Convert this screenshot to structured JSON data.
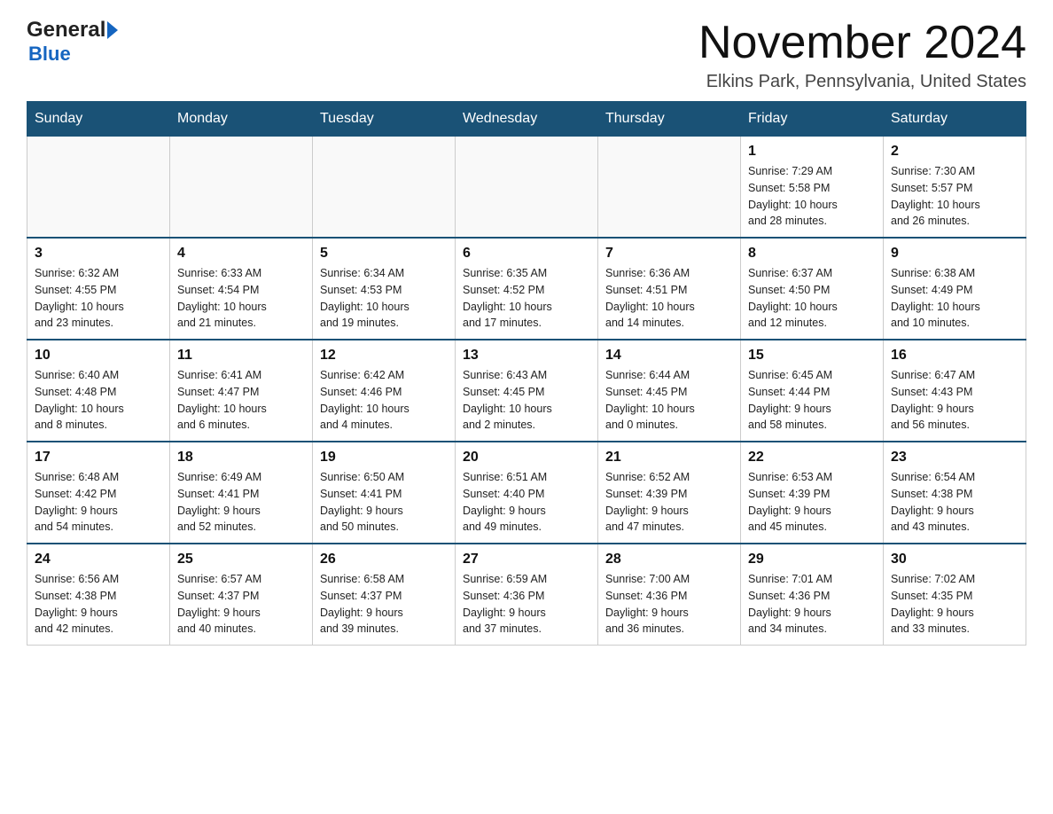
{
  "logo": {
    "general": "General",
    "blue": "Blue"
  },
  "title": "November 2024",
  "subtitle": "Elkins Park, Pennsylvania, United States",
  "weekdays": [
    "Sunday",
    "Monday",
    "Tuesday",
    "Wednesday",
    "Thursday",
    "Friday",
    "Saturday"
  ],
  "weeks": [
    [
      {
        "day": "",
        "info": ""
      },
      {
        "day": "",
        "info": ""
      },
      {
        "day": "",
        "info": ""
      },
      {
        "day": "",
        "info": ""
      },
      {
        "day": "",
        "info": ""
      },
      {
        "day": "1",
        "info": "Sunrise: 7:29 AM\nSunset: 5:58 PM\nDaylight: 10 hours\nand 28 minutes."
      },
      {
        "day": "2",
        "info": "Sunrise: 7:30 AM\nSunset: 5:57 PM\nDaylight: 10 hours\nand 26 minutes."
      }
    ],
    [
      {
        "day": "3",
        "info": "Sunrise: 6:32 AM\nSunset: 4:55 PM\nDaylight: 10 hours\nand 23 minutes."
      },
      {
        "day": "4",
        "info": "Sunrise: 6:33 AM\nSunset: 4:54 PM\nDaylight: 10 hours\nand 21 minutes."
      },
      {
        "day": "5",
        "info": "Sunrise: 6:34 AM\nSunset: 4:53 PM\nDaylight: 10 hours\nand 19 minutes."
      },
      {
        "day": "6",
        "info": "Sunrise: 6:35 AM\nSunset: 4:52 PM\nDaylight: 10 hours\nand 17 minutes."
      },
      {
        "day": "7",
        "info": "Sunrise: 6:36 AM\nSunset: 4:51 PM\nDaylight: 10 hours\nand 14 minutes."
      },
      {
        "day": "8",
        "info": "Sunrise: 6:37 AM\nSunset: 4:50 PM\nDaylight: 10 hours\nand 12 minutes."
      },
      {
        "day": "9",
        "info": "Sunrise: 6:38 AM\nSunset: 4:49 PM\nDaylight: 10 hours\nand 10 minutes."
      }
    ],
    [
      {
        "day": "10",
        "info": "Sunrise: 6:40 AM\nSunset: 4:48 PM\nDaylight: 10 hours\nand 8 minutes."
      },
      {
        "day": "11",
        "info": "Sunrise: 6:41 AM\nSunset: 4:47 PM\nDaylight: 10 hours\nand 6 minutes."
      },
      {
        "day": "12",
        "info": "Sunrise: 6:42 AM\nSunset: 4:46 PM\nDaylight: 10 hours\nand 4 minutes."
      },
      {
        "day": "13",
        "info": "Sunrise: 6:43 AM\nSunset: 4:45 PM\nDaylight: 10 hours\nand 2 minutes."
      },
      {
        "day": "14",
        "info": "Sunrise: 6:44 AM\nSunset: 4:45 PM\nDaylight: 10 hours\nand 0 minutes."
      },
      {
        "day": "15",
        "info": "Sunrise: 6:45 AM\nSunset: 4:44 PM\nDaylight: 9 hours\nand 58 minutes."
      },
      {
        "day": "16",
        "info": "Sunrise: 6:47 AM\nSunset: 4:43 PM\nDaylight: 9 hours\nand 56 minutes."
      }
    ],
    [
      {
        "day": "17",
        "info": "Sunrise: 6:48 AM\nSunset: 4:42 PM\nDaylight: 9 hours\nand 54 minutes."
      },
      {
        "day": "18",
        "info": "Sunrise: 6:49 AM\nSunset: 4:41 PM\nDaylight: 9 hours\nand 52 minutes."
      },
      {
        "day": "19",
        "info": "Sunrise: 6:50 AM\nSunset: 4:41 PM\nDaylight: 9 hours\nand 50 minutes."
      },
      {
        "day": "20",
        "info": "Sunrise: 6:51 AM\nSunset: 4:40 PM\nDaylight: 9 hours\nand 49 minutes."
      },
      {
        "day": "21",
        "info": "Sunrise: 6:52 AM\nSunset: 4:39 PM\nDaylight: 9 hours\nand 47 minutes."
      },
      {
        "day": "22",
        "info": "Sunrise: 6:53 AM\nSunset: 4:39 PM\nDaylight: 9 hours\nand 45 minutes."
      },
      {
        "day": "23",
        "info": "Sunrise: 6:54 AM\nSunset: 4:38 PM\nDaylight: 9 hours\nand 43 minutes."
      }
    ],
    [
      {
        "day": "24",
        "info": "Sunrise: 6:56 AM\nSunset: 4:38 PM\nDaylight: 9 hours\nand 42 minutes."
      },
      {
        "day": "25",
        "info": "Sunrise: 6:57 AM\nSunset: 4:37 PM\nDaylight: 9 hours\nand 40 minutes."
      },
      {
        "day": "26",
        "info": "Sunrise: 6:58 AM\nSunset: 4:37 PM\nDaylight: 9 hours\nand 39 minutes."
      },
      {
        "day": "27",
        "info": "Sunrise: 6:59 AM\nSunset: 4:36 PM\nDaylight: 9 hours\nand 37 minutes."
      },
      {
        "day": "28",
        "info": "Sunrise: 7:00 AM\nSunset: 4:36 PM\nDaylight: 9 hours\nand 36 minutes."
      },
      {
        "day": "29",
        "info": "Sunrise: 7:01 AM\nSunset: 4:36 PM\nDaylight: 9 hours\nand 34 minutes."
      },
      {
        "day": "30",
        "info": "Sunrise: 7:02 AM\nSunset: 4:35 PM\nDaylight: 9 hours\nand 33 minutes."
      }
    ]
  ]
}
